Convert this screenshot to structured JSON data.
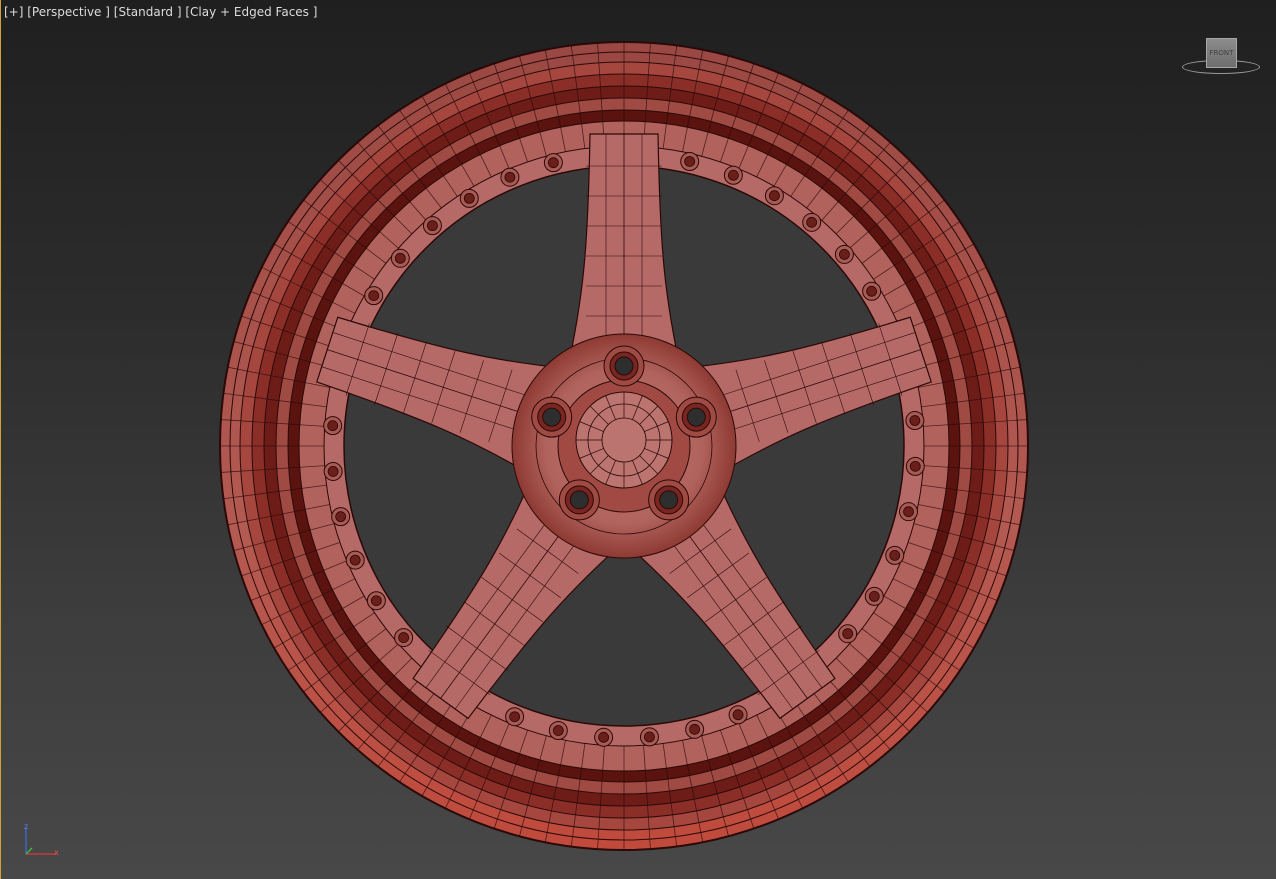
{
  "viewport": {
    "labels": {
      "menu": "[+]",
      "view": "[Perspective ]",
      "shading_preset": "[Standard ]",
      "shading_mode": "[Clay + Edged Faces ]"
    },
    "viewcube": {
      "face_label": "FRONT"
    },
    "axis_tripod": {
      "x": "x",
      "z": "z"
    }
  },
  "colors": {
    "background_top": "#1f1f1f",
    "background_bottom": "#484848",
    "clay": "#b66a68",
    "clay_dark": "#7d2c25",
    "edge_wire": "#2a0a08",
    "label_text": "#dcdcdc",
    "active_border": "#c9a53a"
  },
  "model": {
    "type": "wheel",
    "spokes": 5,
    "lug_holes": 5,
    "rim_bolts": 40
  }
}
